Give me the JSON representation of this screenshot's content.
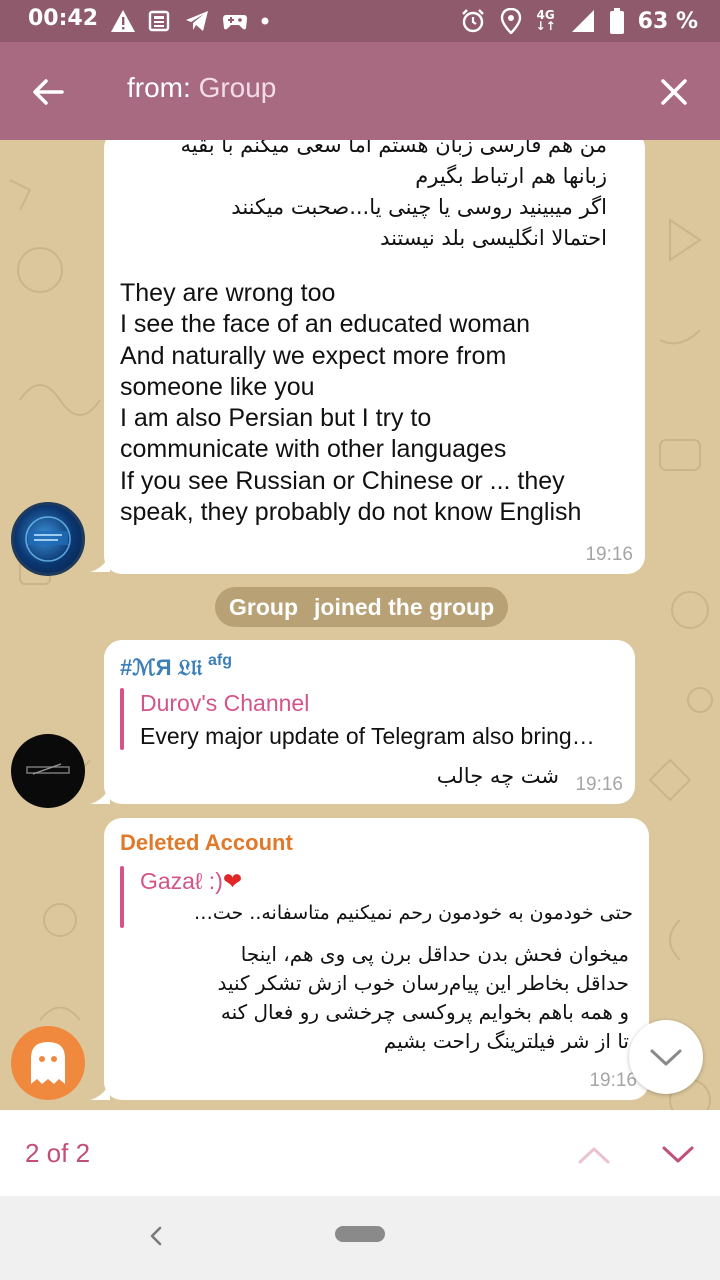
{
  "status_bar": {
    "time": "00:42",
    "network": "4G",
    "battery": "63 %"
  },
  "header": {
    "search_prefix": "from: ",
    "search_value": "Group",
    "back_icon": "arrow-left-icon",
    "close_icon": "close-icon"
  },
  "messages": [
    {
      "text_rtl": "من هم فارسی زبان هستم اما سعی میکنم با بقیه\nزبانها هم ارتباط بگیرم\nاگر میبینید روسی یا چینی یا...صحبت میکنند\nاحتمالا انگلیسی بلد نیستند",
      "text_en": "They are wrong too\nI see the face of an educated woman\nAnd naturally we expect more from\nsomeone like you\nI am also Persian but I try to\ncommunicate with other languages\nIf you see Russian or Chinese or ... they\nspeak, they probably do not know English",
      "time": "19:16"
    },
    {
      "sender": "#ℳЯ 𝔏𝔩𝔦",
      "sender_suffix": "afg",
      "reply_name": "Durov's Channel",
      "reply_text": "Every major update of Telegram also bring…",
      "text": "شت چه جالب",
      "time": "19:16"
    },
    {
      "sender": "Deleted Account",
      "reply_name": "Gazaℓ :)",
      "reply_text": "حتی خودمون به خودمون رحم نمیکنیم متاسفانه.. حت…",
      "text": "میخوان فحش بدن حداقل برن پی وی هم، اینجا\nحداقل بخاطر این پیام‌رسان خوب ازش تشکر کنید\nو همه باهم بخوایم پروکسی چرخشی رو فعال کنه\nتا از شر فیلترینگ راحت بشیم",
      "time": "19:16"
    }
  ],
  "service": {
    "name": "Group",
    "action": "joined the group"
  },
  "search_nav": {
    "counter": "2 of 2"
  },
  "colors": {
    "status_bar": "#8e5a6c",
    "header": "#a86a80",
    "accent": "#c24f79",
    "reply": "#d4548a",
    "sender_blue": "#3d7fb8",
    "sender_orange": "#e07a2a"
  }
}
